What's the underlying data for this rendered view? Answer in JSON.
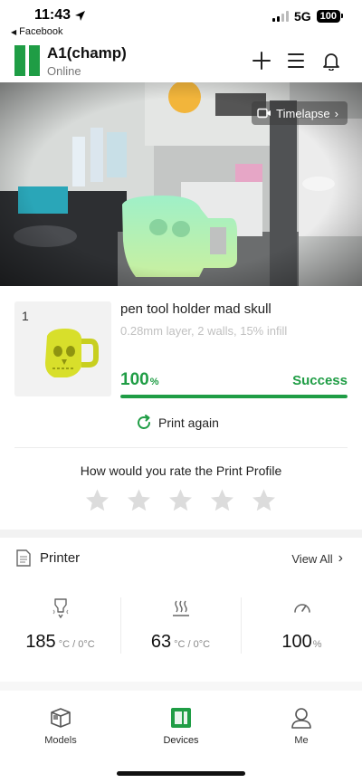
{
  "status_bar": {
    "time": "11:43",
    "back_app": "Facebook",
    "network": "5G",
    "battery": "100"
  },
  "header": {
    "device_name": "A1(champ)",
    "device_status": "Online",
    "brand_color": "#1f9d45",
    "actions": [
      "plus-icon",
      "menu-icon",
      "bell-icon"
    ]
  },
  "camera": {
    "timelapse_label": "Timelapse"
  },
  "job": {
    "thumbnail_number": "1",
    "title": "pen tool holder mad skull",
    "details": "0.28mm layer, 2 walls, 15% infill",
    "progress_value": "100",
    "progress_unit": "%",
    "progress_fraction": 1.0,
    "status": "Success",
    "print_again_label": "Print again"
  },
  "rating": {
    "prompt": "How would you rate the Print Profile",
    "max_stars": 5,
    "selected": 0
  },
  "printer": {
    "title": "Printer",
    "view_all_label": "View All",
    "nozzle": {
      "value": "185",
      "unit": "°C / 0°C",
      "icon": "nozzle-icon"
    },
    "bed": {
      "value": "63",
      "unit": "°C / 0°C",
      "icon": "heatbed-icon"
    },
    "speed": {
      "value": "100",
      "unit": "%",
      "icon": "speed-gauge-icon"
    }
  },
  "tabs": [
    {
      "label": "Models",
      "icon": "models-icon",
      "active": false
    },
    {
      "label": "Devices",
      "icon": "devices-icon",
      "active": true
    },
    {
      "label": "Me",
      "icon": "profile-icon",
      "active": false
    }
  ],
  "colors": {
    "accent": "#1f9d45",
    "muted_text": "#c0c0c0",
    "star_empty": "#dcdcdc"
  }
}
